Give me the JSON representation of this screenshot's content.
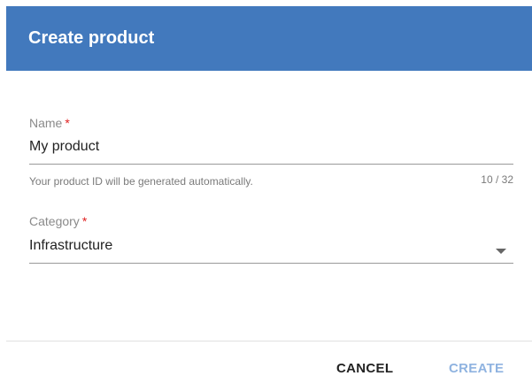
{
  "dialog": {
    "title": "Create product"
  },
  "name_field": {
    "label": "Name",
    "required_mark": "*",
    "value": "My product",
    "hint": "Your product ID will be generated automatically.",
    "counter": "10 / 32"
  },
  "category_field": {
    "label": "Category",
    "required_mark": "*",
    "value": "Infrastructure"
  },
  "actions": {
    "cancel_label": "CANCEL",
    "create_label": "CREATE"
  },
  "colors": {
    "header_bg": "#4279bd",
    "required": "#e02020",
    "create_disabled": "#8fb3e0"
  },
  "icons": {
    "category_dropdown": "caret-down-icon"
  }
}
